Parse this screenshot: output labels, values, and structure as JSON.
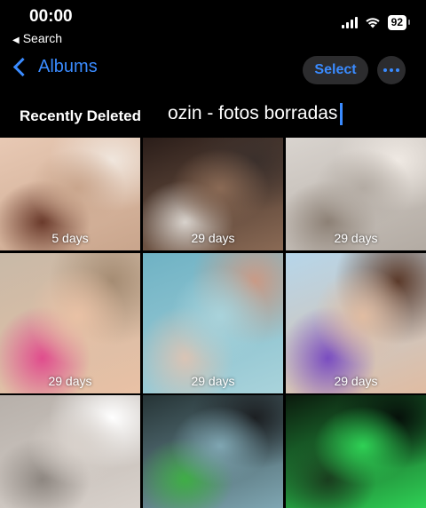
{
  "status_bar": {
    "time": "00:00",
    "back_app": "Search",
    "battery": "92"
  },
  "nav": {
    "back_label": "Albums",
    "select_label": "Select"
  },
  "title": "Recently Deleted",
  "overlay_caption": "ozin - fotos borradas",
  "photos": [
    {
      "days": "5 days",
      "palette": [
        "#e8c9b4",
        "#c9a58c",
        "#6b3b2c",
        "#f0e6dd"
      ]
    },
    {
      "days": "29 days",
      "palette": [
        "#2a1d19",
        "#8a6a55",
        "#d8d2cc",
        "#3b302c"
      ]
    },
    {
      "days": "29 days",
      "palette": [
        "#d9d4cf",
        "#b3aba3",
        "#8d8176",
        "#efe9e3"
      ]
    },
    {
      "days": "29 days",
      "palette": [
        "#c8b9a7",
        "#e9c1a5",
        "#e04d8d",
        "#a58c73"
      ]
    },
    {
      "days": "29 days",
      "palette": [
        "#6fb2c4",
        "#a9d3db",
        "#d9c4b5",
        "#c99a86"
      ]
    },
    {
      "days": "29 days",
      "palette": [
        "#b6d6ea",
        "#e0bca2",
        "#7a4dc0",
        "#5b3a2a"
      ]
    },
    {
      "days": "",
      "palette": [
        "#b7b0aa",
        "#d8d1cb",
        "#8e8781",
        "#ffffff"
      ]
    },
    {
      "days": "",
      "palette": [
        "#263436",
        "#7fa6b2",
        "#3fae46",
        "#1c1f22"
      ]
    },
    {
      "days": "",
      "palette": [
        "#0b1a0d",
        "#2fd155",
        "#1a3d1e",
        "#06100a"
      ]
    }
  ]
}
